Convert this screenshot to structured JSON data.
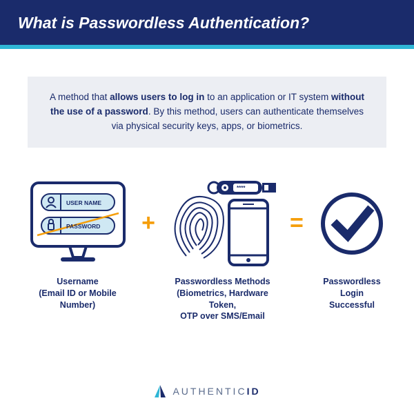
{
  "title": "What is Passwordless Authentication?",
  "definition": {
    "prefix": "A method that ",
    "bold1": "allows users to log in",
    "mid": " to an application or IT system ",
    "bold2": "without the use of a password",
    "suffix": ". By this method, users can authenticate themselves via physical security keys, apps, or biometrics."
  },
  "credential_fields": {
    "username": "USER NAME",
    "password": "PASSWORD"
  },
  "token_label": "****",
  "items": [
    {
      "caption_l1": "Username",
      "caption_l2": "(Email ID or Mobile Number)"
    },
    {
      "caption_l1": "Passwordless Methods",
      "caption_l2": "(Biometrics, Hardware Token,",
      "caption_l3": "OTP over SMS/Email"
    },
    {
      "caption_l1": "Passwordless Login",
      "caption_l2": "Successful"
    }
  ],
  "ops": {
    "plus": "+",
    "equals": "="
  },
  "brand": {
    "left": "AUTHENTIC",
    "right": "ID"
  }
}
